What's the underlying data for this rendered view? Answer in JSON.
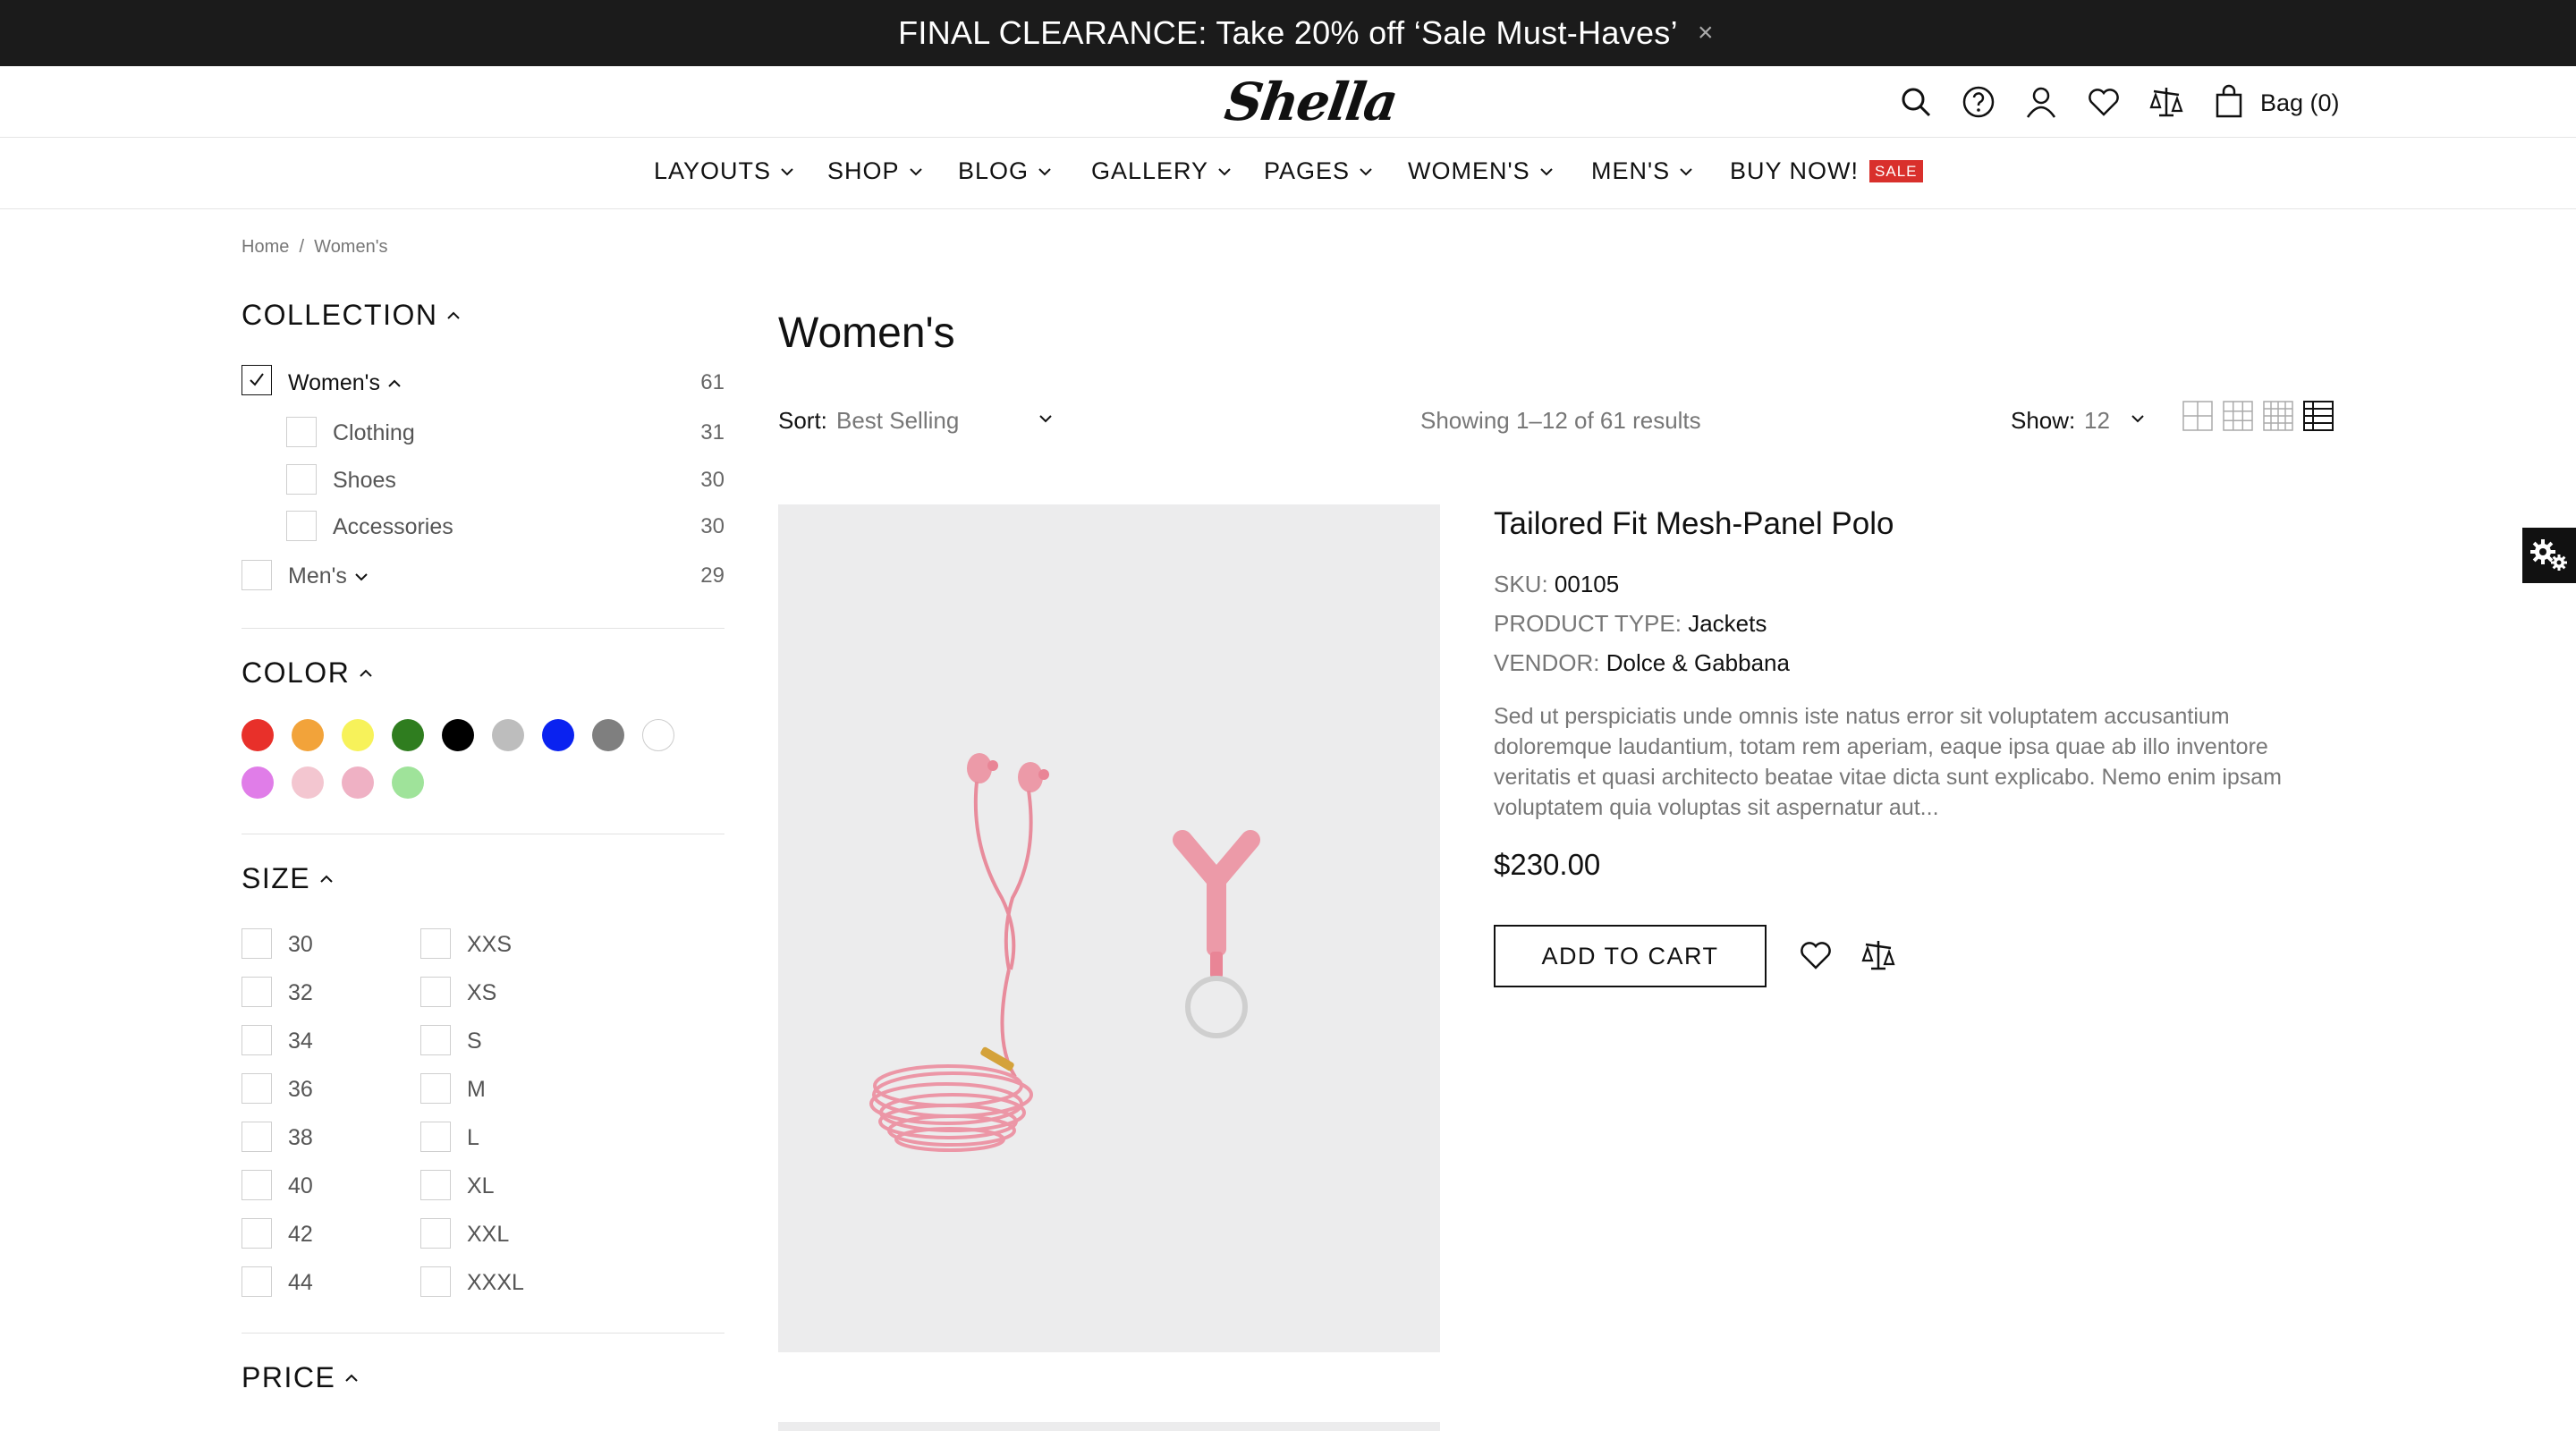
{
  "promo": {
    "text": "FINAL CLEARANCE: Take 20% off ‘Sale Must-Haves’",
    "close": "×"
  },
  "header": {
    "logo": "Shella",
    "bag_label": "Bag (0)",
    "icons": [
      "search-icon",
      "help-icon",
      "account-icon",
      "wishlist-icon",
      "compare-icon",
      "bag-icon"
    ]
  },
  "nav": {
    "items": [
      "LAYOUTS",
      "SHOP",
      "BLOG",
      "GALLERY",
      "PAGES",
      "WOMEN'S",
      "MEN'S"
    ],
    "buy_now": "BUY NOW!",
    "sale_badge": "SALE"
  },
  "breadcrumb": {
    "home": "Home",
    "separator": "/",
    "current": "Women's"
  },
  "sidebar": {
    "collection": {
      "title": "COLLECTION",
      "womens": {
        "label": "Women's",
        "count": "61",
        "checked": true
      },
      "children": [
        {
          "label": "Clothing",
          "count": "31"
        },
        {
          "label": "Shoes",
          "count": "30"
        },
        {
          "label": "Accessories",
          "count": "30"
        }
      ],
      "mens": {
        "label": "Men's",
        "count": "29"
      }
    },
    "color": {
      "title": "COLOR",
      "swatches": [
        "#e8302a",
        "#f2a33a",
        "#f7f25a",
        "#2f7d1f",
        "#000000",
        "#bdbdbd",
        "#0a22f0",
        "#7f7f7f",
        "#ffffff",
        "#e07de8",
        "#f3c6d0",
        "#efb1c4",
        "#9fe39a"
      ]
    },
    "size": {
      "title": "SIZE",
      "numeric": [
        "30",
        "32",
        "34",
        "36",
        "38",
        "40",
        "42",
        "44"
      ],
      "letter": [
        "XXS",
        "XS",
        "S",
        "M",
        "L",
        "XL",
        "XXL",
        "XXXL"
      ]
    },
    "price": {
      "title": "PRICE"
    }
  },
  "main": {
    "title": "Women's",
    "sort_label": "Sort:",
    "sort_value": "Best Selling",
    "results": "Showing 1–12 of 61 results",
    "show_label": "Show:",
    "show_value": "12",
    "view_modes": [
      "grid-2-icon",
      "grid-3-icon",
      "grid-4-icon",
      "list-view-icon"
    ],
    "active_view": "list-view-icon"
  },
  "product": {
    "title": "Tailored Fit Mesh-Panel Polo",
    "sku_label": "SKU:",
    "sku": "00105",
    "type_label": "PRODUCT TYPE:",
    "type": "Jackets",
    "vendor_label": "VENDOR:",
    "vendor": "Dolce & Gabbana",
    "description": "Sed ut perspiciatis unde omnis iste natus error sit voluptatem accusantium doloremque laudantium, totam rem aperiam, eaque ipsa quae ab illo inventore veritatis et quasi architecto beatae vitae dicta sunt explicabo. Nemo enim ipsam voluptatem quia voluptas sit aspernatur aut...",
    "price": "$230.00",
    "add_to_cart": "ADD TO CART"
  },
  "colors": {
    "accent_sale": "#d9302c",
    "promo_bg": "#1b1b1b",
    "product_pink": "#ec9aa8"
  }
}
